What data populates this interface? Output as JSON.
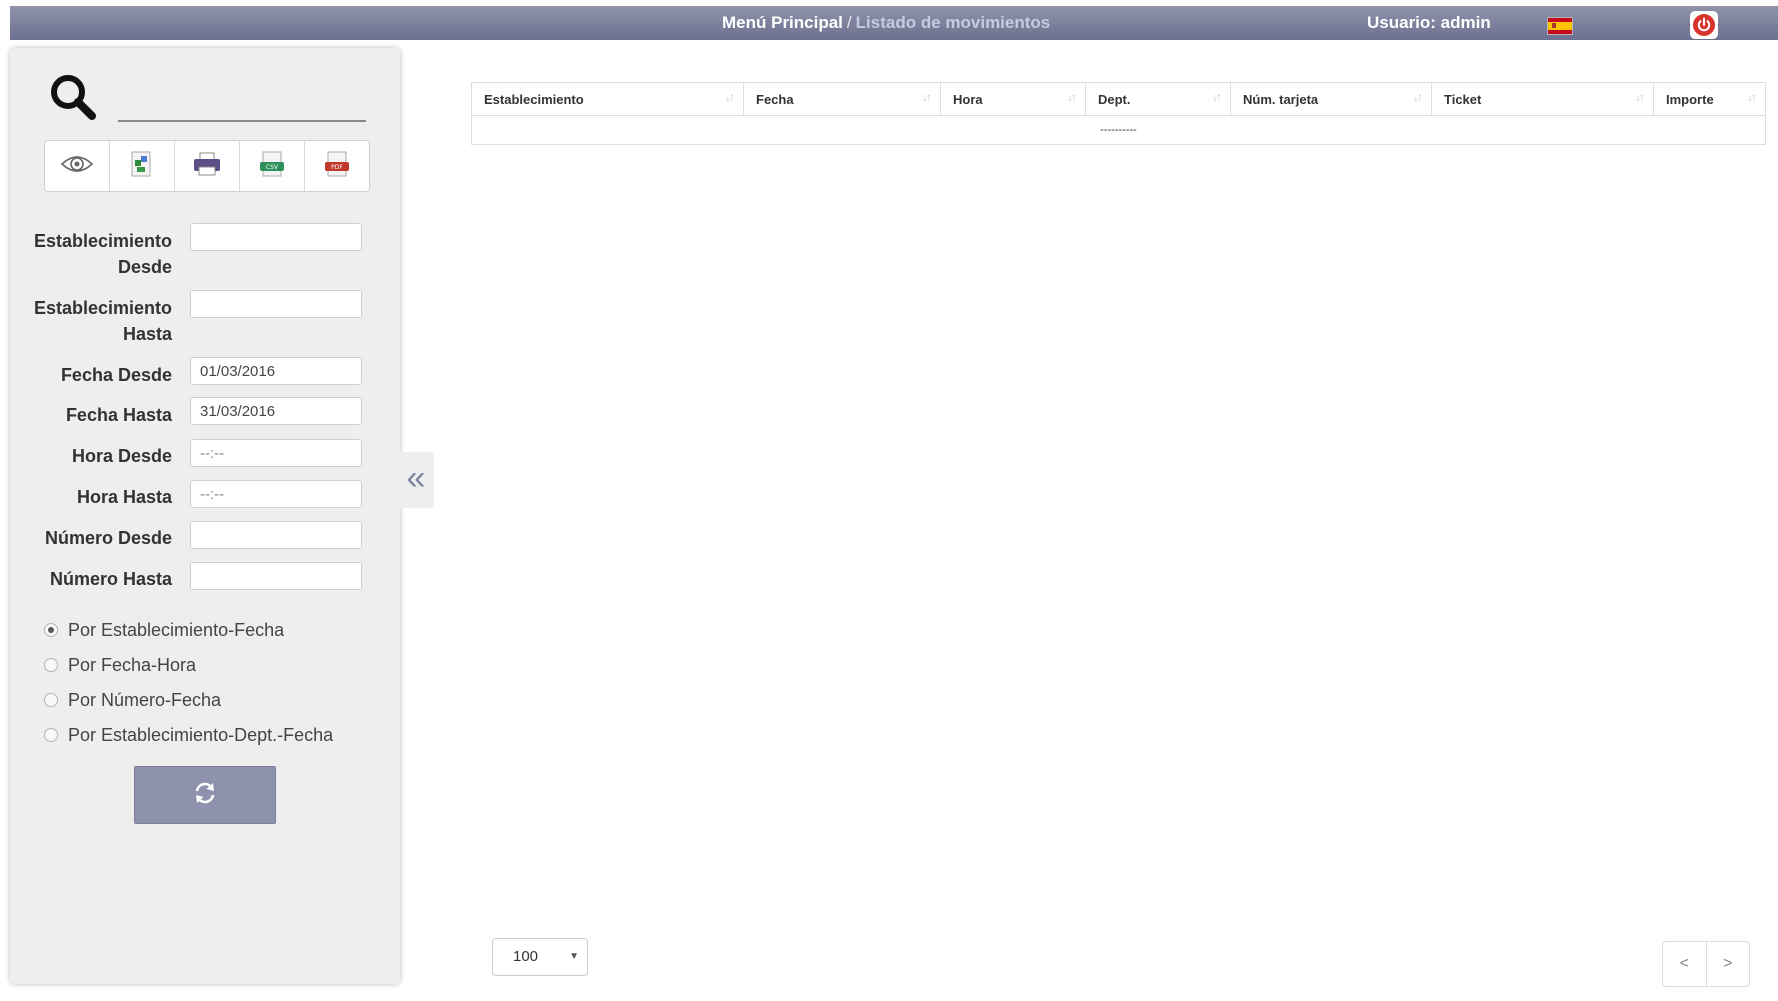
{
  "header": {
    "breadcrumb_home": "Menú Principal",
    "breadcrumb_separator": "/",
    "breadcrumb_current": "Listado de movimientos",
    "user_label": "Usuario: admin",
    "language_flag": "spain-flag-icon",
    "logout_icon": "power-icon"
  },
  "toolbar": {
    "buttons": [
      {
        "icon": "eye-icon"
      },
      {
        "icon": "excel-export-icon"
      },
      {
        "icon": "print-icon"
      },
      {
        "icon": "csv-export-icon",
        "badge": "CSV"
      },
      {
        "icon": "pdf-export-icon",
        "badge": "PDF"
      }
    ]
  },
  "filters": {
    "establecimiento_desde": {
      "label_line1": "Establecimiento",
      "label_line2": "Desde",
      "value": ""
    },
    "establecimiento_hasta": {
      "label_line1": "Establecimiento",
      "label_line2": "Hasta",
      "value": ""
    },
    "fecha_desde": {
      "label": "Fecha Desde",
      "value": "01/03/2016"
    },
    "fecha_hasta": {
      "label": "Fecha Hasta",
      "value": "31/03/2016"
    },
    "hora_desde": {
      "label": "Hora Desde",
      "placeholder": "--:--"
    },
    "hora_hasta": {
      "label": "Hora Hasta",
      "placeholder": "--:--"
    },
    "numero_desde": {
      "label": "Número Desde",
      "value": ""
    },
    "numero_hasta": {
      "label": "Número Hasta",
      "value": ""
    }
  },
  "order_options": [
    {
      "label": "Por Establecimiento-Fecha",
      "selected": true
    },
    {
      "label": "Por Fecha-Hora",
      "selected": false
    },
    {
      "label": "Por Número-Fecha",
      "selected": false
    },
    {
      "label": "Por Establecimiento-Dept.-Fecha",
      "selected": false
    }
  ],
  "collapse_label": "«",
  "table": {
    "columns": [
      "Establecimiento",
      "Fecha",
      "Hora",
      "Dept.",
      "Núm. tarjeta",
      "Ticket",
      "Importe"
    ],
    "empty_row": "----------"
  },
  "footer": {
    "page_size": "100",
    "prev_label": "<",
    "next_label": ">"
  },
  "colors": {
    "topbar": "#7c809e",
    "accent_button": "#8e92ad",
    "logout": "#d9342b"
  }
}
